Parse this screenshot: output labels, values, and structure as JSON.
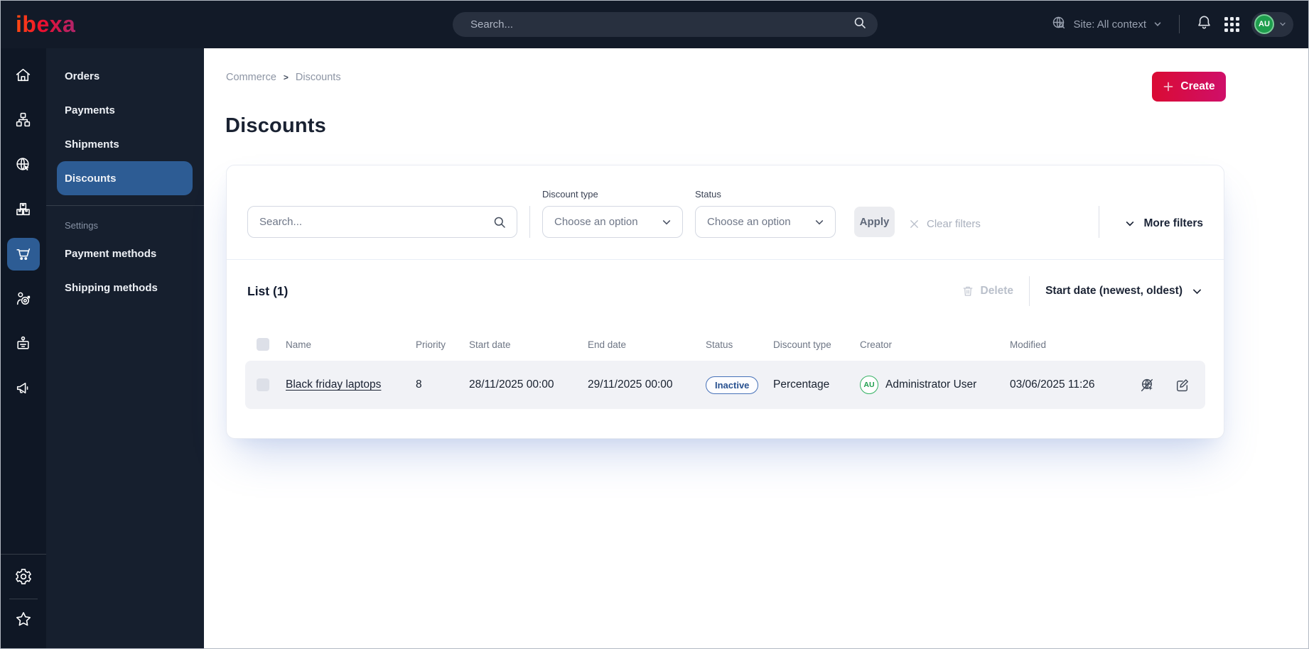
{
  "topbar": {
    "logo": "ibexa",
    "search_placeholder": "Search...",
    "site_context": "Site: All context",
    "avatar_initials": "AU"
  },
  "sidebar": {
    "rail_icons": [
      "home-icon",
      "content-structure-icon",
      "site-globe-icon",
      "products-boxes-icon",
      "commerce-cart-icon",
      "customer-target-icon",
      "personnel-badge-icon",
      "marketing-megaphone-icon",
      "settings-gear-icon",
      "favorites-star-icon"
    ],
    "active_icon": "commerce-cart-icon",
    "menu": {
      "items": [
        "Orders",
        "Payments",
        "Shipments",
        "Discounts"
      ],
      "active_item": "Discounts",
      "section_label": "Settings",
      "settings_items": [
        "Payment methods",
        "Shipping methods"
      ]
    }
  },
  "breadcrumb": {
    "items": [
      "Commerce",
      "Discounts"
    ],
    "separator": ">"
  },
  "header": {
    "create_label": "Create",
    "page_title": "Discounts"
  },
  "filters": {
    "search_placeholder": "Search...",
    "discount_type_label": "Discount type",
    "discount_type_value": "Choose an option",
    "status_label": "Status",
    "status_value": "Choose an option",
    "apply_label": "Apply",
    "clear_label": "Clear filters",
    "more_filters_label": "More filters"
  },
  "list": {
    "title": "List (1)",
    "delete_label": "Delete",
    "sort_label": "Start date (newest, oldest)",
    "columns": [
      "Name",
      "Priority",
      "Start date",
      "End date",
      "Status",
      "Discount type",
      "Creator",
      "Modified"
    ],
    "rows": [
      {
        "name": "Black friday laptops",
        "priority": "8",
        "start_date": "28/11/2025 00:00",
        "end_date": "29/11/2025 00:00",
        "status": "Inactive",
        "discount_type": "Percentage",
        "creator_initials": "AU",
        "creator": "Administrator User",
        "modified": "03/06/2025 11:26"
      }
    ]
  },
  "colors": {
    "topbar_bg": "#121a28",
    "rail_bg": "#0f1725",
    "panel_bg": "#161f2e",
    "active_blue": "#2d5c94",
    "brand_gradient_start": "#da0b34",
    "brand_gradient_end": "#cf0f69",
    "badge_blue": "#4671b8",
    "avatar_green": "#1e9e4d"
  }
}
